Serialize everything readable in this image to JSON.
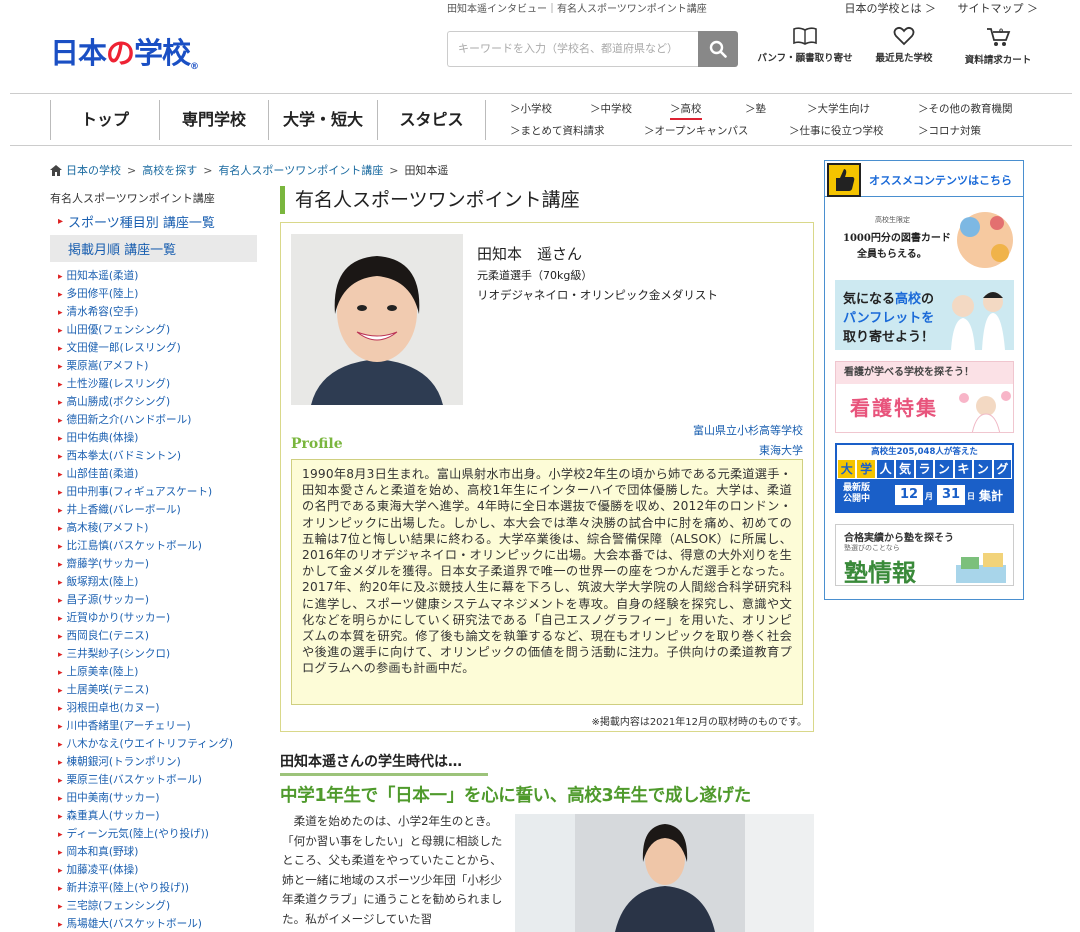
{
  "header": {
    "logo_main": "日本",
    "logo_no": "の",
    "logo_end": "学校",
    "logo_mark": "®",
    "caption": "田知本遥インタビュー｜有名人スポーツワンポイント講座",
    "link_about": "日本の学校とは ＞",
    "link_sitemap": "サイトマップ ＞",
    "search_placeholder": "キーワードを入力（学校名、都道府県など）",
    "icon_pamph": "パンフ・願書取り寄せ",
    "icon_recent": "最近見た学校",
    "icon_cart": "資料請求カート"
  },
  "gnav": {
    "main": [
      "トップ",
      "専門学校",
      "大学・短大",
      "スタピス"
    ],
    "sub_row1": [
      "＞小学校",
      "＞中学校",
      "＞高校",
      "＞塾",
      "＞大学生向け",
      "＞その他の教育機関"
    ],
    "sub_row2": [
      "＞まとめて資料請求",
      "＞オープンキャンパス",
      "＞仕事に役立つ学校",
      "＞コロナ対策"
    ]
  },
  "breadcrumb": {
    "home": "日本の学校",
    "b1": "高校を探す",
    "b2": "有名人スポーツワンポイント講座",
    "current": "田知本遥",
    "sep": ">"
  },
  "sidebar": {
    "title": "有名人スポーツワンポイント講座",
    "cat1": "スポーツ種目別 講座一覧",
    "cat2": "掲載月順 講座一覧",
    "items": [
      "田知本遥(柔道)",
      "多田修平(陸上)",
      "清水希容(空手)",
      "山田優(フェンシング)",
      "文田健一郎(レスリング)",
      "栗原嵩(アメフト)",
      "土性沙羅(レスリング)",
      "高山勝成(ボクシング)",
      "德田新之介(ハンドボール)",
      "田中佑典(体操)",
      "西本拳太(バドミントン)",
      "山部佳苗(柔道)",
      "田中刑事(フィギュアスケート)",
      "井上香織(バレーボール)",
      "高木稜(アメフト)",
      "比江島慎(バスケットボール)",
      "齋藤学(サッカー)",
      "飯塚翔太(陸上)",
      "昌子源(サッカー)",
      "近賀ゆかり(サッカー)",
      "西岡良仁(テニス)",
      "三井梨紗子(シンクロ)",
      "上原美幸(陸上)",
      "土居美咲(テニス)",
      "羽根田卓也(カヌー)",
      "川中香緒里(アーチェリー)",
      "八木かなえ(ウエイトリフティング)",
      "棟朝銀河(トランポリン)",
      "栗原三佳(バスケットボール)",
      "田中美南(サッカー)",
      "森重真人(サッカー)",
      "ディーン元気(陸上(やり投げ))",
      "岡本和真(野球)",
      "加藤凌平(体操)",
      "新井涼平(陸上(やり投げ))",
      "三宅諒(フェンシング)",
      "馬場雄大(バスケットボール)"
    ]
  },
  "main": {
    "title": "有名人スポーツワンポイント講座",
    "name": "田知本　遥さん",
    "sub1": "元柔道選手（70kg級）",
    "sub2": "リオデジャネイロ・オリンピック金メダリスト",
    "school1": "富山県立小杉高等学校",
    "school2": "東海大学",
    "profile_label": "Profile",
    "bio": "1990年8月3日生まれ。富山県射水市出身。小学校2年生の頃から姉である元柔道選手・田知本愛さんと柔道を始め、高校1年生にインターハイで団体優勝した。大学は、柔道の名門である東海大学へ進学。4年時に全日本選抜で優勝を収め、2012年のロンドン・オリンピックに出場した。しかし、本大会では準々決勝の試合中に肘を痛め、初めての五輪は7位と悔しい結果に終わる。大学卒業後は、綜合警備保障（ALSOK）に所属し、2016年のリオデジャネイロ・オリンピックに出場。大会本番では、得意の大外刈りを生かして金メダルを獲得。日本女子柔道界で唯一の世界一の座をつかんだ選手となった。2017年、約20年に及ぶ競技人生に幕を下ろし、筑波大学大学院の人間総合科学研究科に進学し、スポーツ健康システムマネジメントを専攻。自身の経験を探究し、意識や文化などを明らかにしていく研究法である「自己エスノグラフィー」を用いた、オリンピズムの本質を研究。修了後も論文を執筆するなど、現在もオリンピックを取り巻く社会や後進の選手に向けて、オリンピックの価値を問う活動に注力。子供向けの柔道教育プログラムへの参画も計画中だ。",
    "note": "※掲載内容は2021年12月の取材時のものです。",
    "sec_head": "田知本遥さんの学生時代は…",
    "sec_h2": "中学1年生で「日本一」を心に誓い、高校3年生で成し遂げた",
    "sec_text": "柔道を始めたのは、小学2年生のとき。「何か習い事をしたい」と母親に相談したところ、父も柔道をやっていたことから、姉と一緒に地域のスポーツ少年団「小杉少年柔道クラブ」に通うことを勧められました。私がイメージしていた習"
  },
  "right": {
    "head": "オススメコンテンツはこちら",
    "b1_small": "高校生限定",
    "b1_line1": "1000円分の図書カード",
    "b1_line2": "全員もらえる。",
    "b2_line1": "気になる",
    "b2_hl": "高校",
    "b2_line1b": "の",
    "b2_line2": "パンフレットを",
    "b2_line3": "取り寄せよう！",
    "b3_top": "看護が学べる学校を探そう！",
    "b3_main": "看護特集",
    "b4_top": "高校生205,048人が答えた",
    "b4_rank": [
      "大",
      "学",
      "人",
      "気",
      "ラ",
      "ン",
      "キ",
      "ン",
      "グ"
    ],
    "b4_new": "最新版",
    "b4_pub": "公開中",
    "b4_month": "12",
    "b4_month_unit": "月",
    "b4_day": "31",
    "b4_day_unit": "日",
    "b4_tally": "集計",
    "b5_top": "合格実績から塾を探そう",
    "b5_hl": "塾",
    "b5_sub": "塾選びのことなら",
    "b5_main": "塾情報"
  }
}
